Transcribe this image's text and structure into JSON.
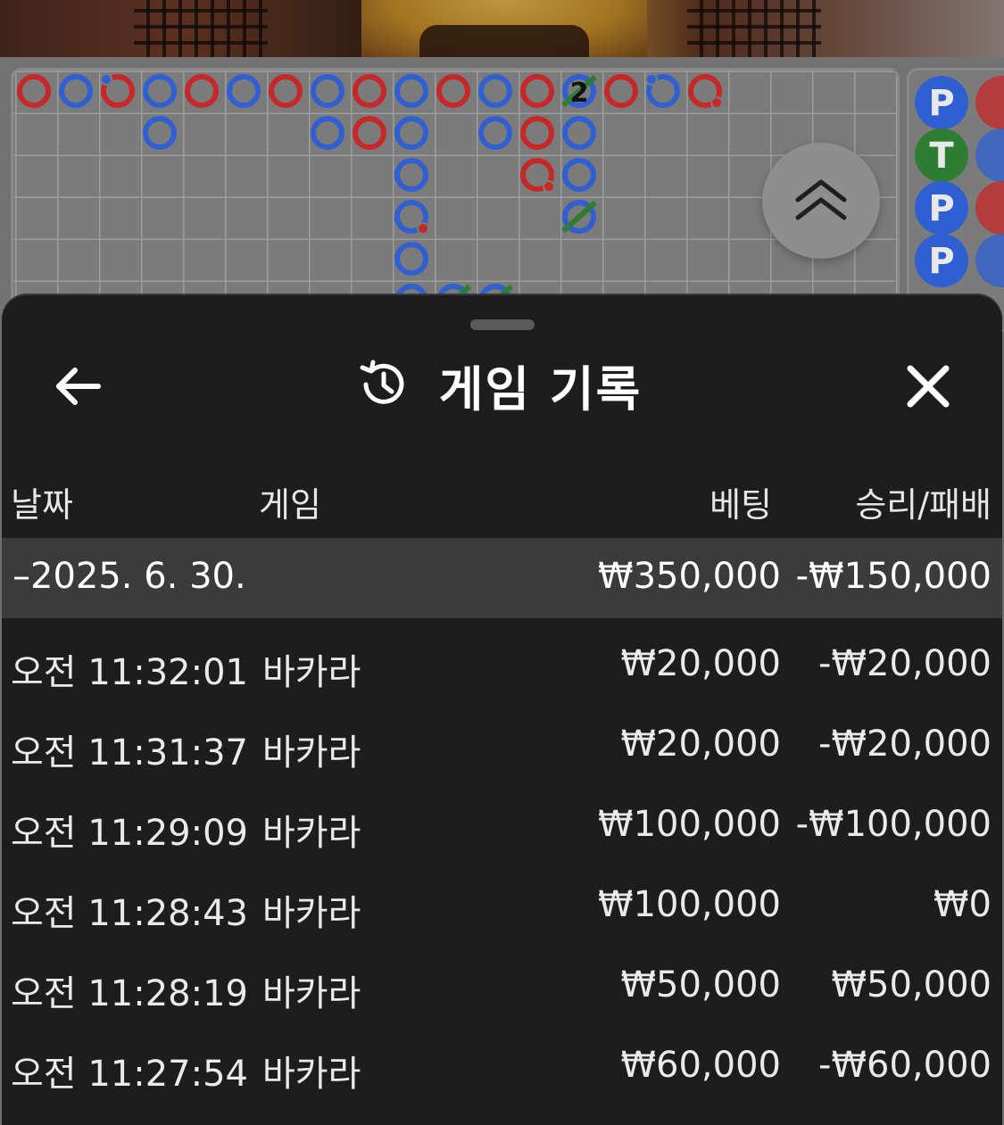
{
  "title": "게임 기록",
  "columns": {
    "date": "날짜",
    "game": "게임",
    "bet": "베팅",
    "win_loss": "승리/패배"
  },
  "date_group": {
    "label": "–2025. 6. 30.",
    "bet_total": "₩350,000",
    "win_loss_total": "-₩150,000"
  },
  "rows": [
    {
      "time": "오전 11:32:01",
      "game": "바카라",
      "bet": "₩20,000",
      "win_loss": "-₩20,000"
    },
    {
      "time": "오전 11:31:37",
      "game": "바카라",
      "bet": "₩20,000",
      "win_loss": "-₩20,000"
    },
    {
      "time": "오전 11:29:09",
      "game": "바카라",
      "bet": "₩100,000",
      "win_loss": "-₩100,000"
    },
    {
      "time": "오전 11:28:43",
      "game": "바카라",
      "bet": "₩100,000",
      "win_loss": "₩0"
    },
    {
      "time": "오전 11:28:19",
      "game": "바카라",
      "bet": "₩50,000",
      "win_loss": "₩50,000"
    },
    {
      "time": "오전 11:27:54",
      "game": "바카라",
      "bet": "₩60,000",
      "win_loss": "-₩60,000"
    }
  ],
  "roadmap": {
    "tie_count_label": "2",
    "side_beads": [
      "P",
      "T",
      "P",
      "P"
    ],
    "colors": {
      "banker": "#c62828",
      "player": "#2f5fd0",
      "tie": "#2e7d32"
    }
  },
  "icons": {
    "back": "arrow-left-icon",
    "history": "history-clock-icon",
    "close": "close-icon",
    "collapse": "chevron-double-up-icon"
  }
}
